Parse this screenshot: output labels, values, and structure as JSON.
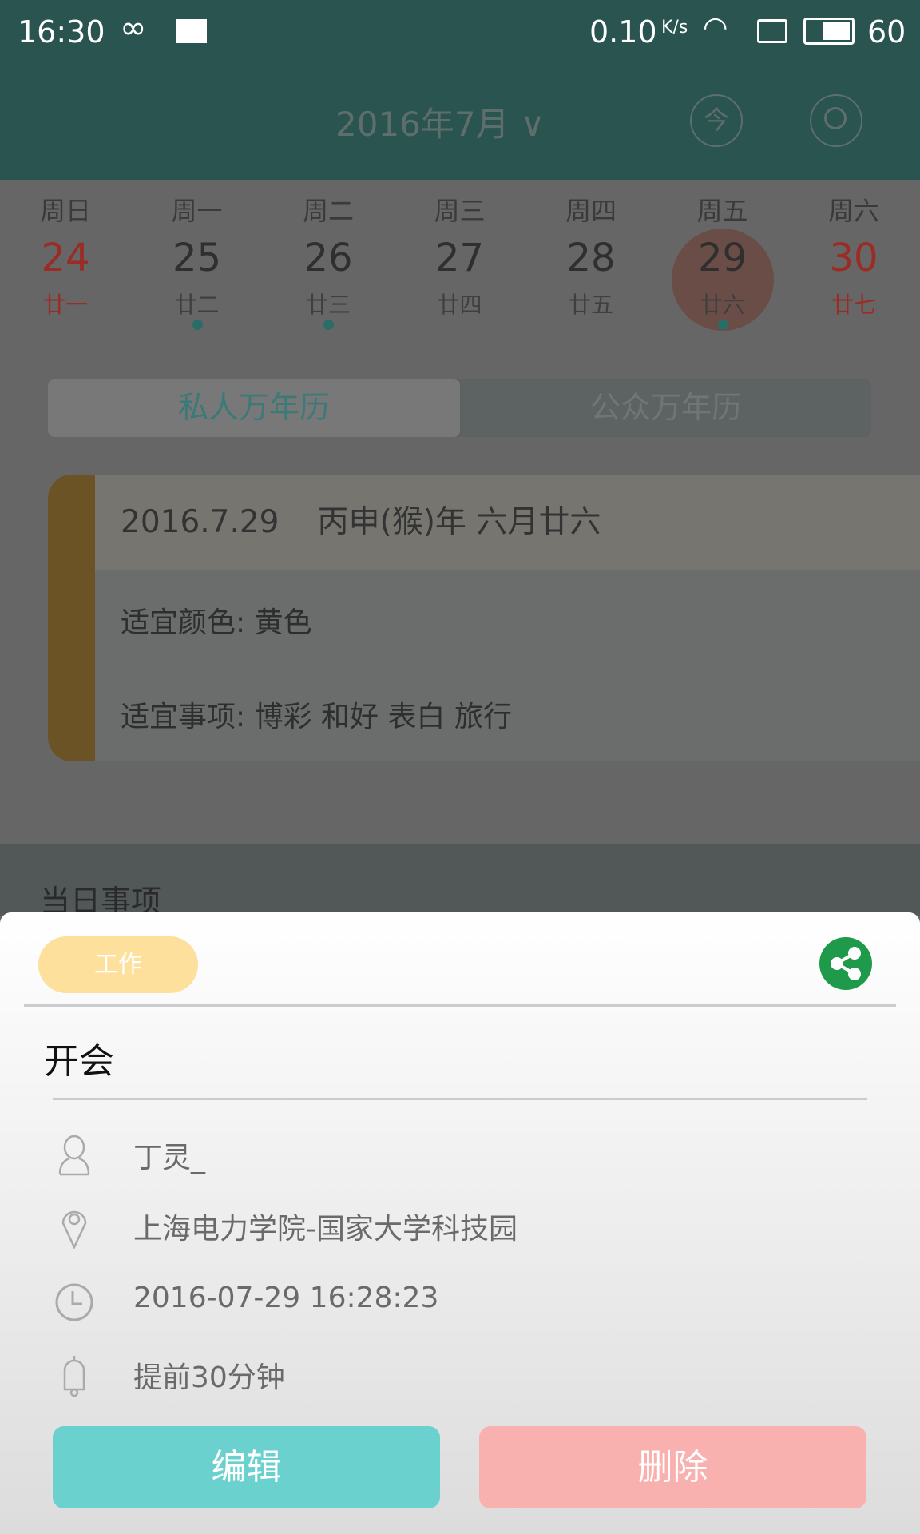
{
  "status_bar": {
    "time": "16:30",
    "speed": "0.10",
    "speed_unit": "K/s",
    "battery": "60"
  },
  "header": {
    "title": "2016年7月",
    "today_label": "今"
  },
  "week": {
    "days": [
      {
        "name": "周日",
        "date": "24",
        "lunar": "廿一",
        "weekend": true,
        "has_event": false
      },
      {
        "name": "周一",
        "date": "25",
        "lunar": "廿二",
        "weekend": false,
        "has_event": true
      },
      {
        "name": "周二",
        "date": "26",
        "lunar": "廿三",
        "weekend": false,
        "has_event": true
      },
      {
        "name": "周三",
        "date": "27",
        "lunar": "廿四",
        "weekend": false,
        "has_event": false
      },
      {
        "name": "周四",
        "date": "28",
        "lunar": "廿五",
        "weekend": false,
        "has_event": false
      },
      {
        "name": "周五",
        "date": "29",
        "lunar": "廿六",
        "weekend": false,
        "has_event": true,
        "selected": true
      },
      {
        "name": "周六",
        "date": "30",
        "lunar": "廿七",
        "weekend": true,
        "has_event": false
      }
    ]
  },
  "tabs": {
    "private": "私人万年历",
    "public": "公众万年历",
    "active": "private"
  },
  "almanac": {
    "date": "2016.7.29",
    "lunar": "丙申(猴)年 六月廿六",
    "color_line": "适宜颜色: 黄色",
    "matters_line": "适宜事项: 博彩 和好 表白 旅行"
  },
  "events_section": {
    "title": "当日事项"
  },
  "dialog": {
    "tag": "工作",
    "title": "开会",
    "person": "丁灵_",
    "location": "上海电力学院-国家大学科技园",
    "time": "2016-07-29 16:28:23",
    "reminder": "提前30分钟",
    "edit": "编辑",
    "delete": "删除"
  },
  "colors": {
    "header": "#2a5450",
    "tag": "#fde09c",
    "share": "#1f9a4a",
    "edit": "#6ad1cf",
    "delete": "#f8b1ae"
  }
}
